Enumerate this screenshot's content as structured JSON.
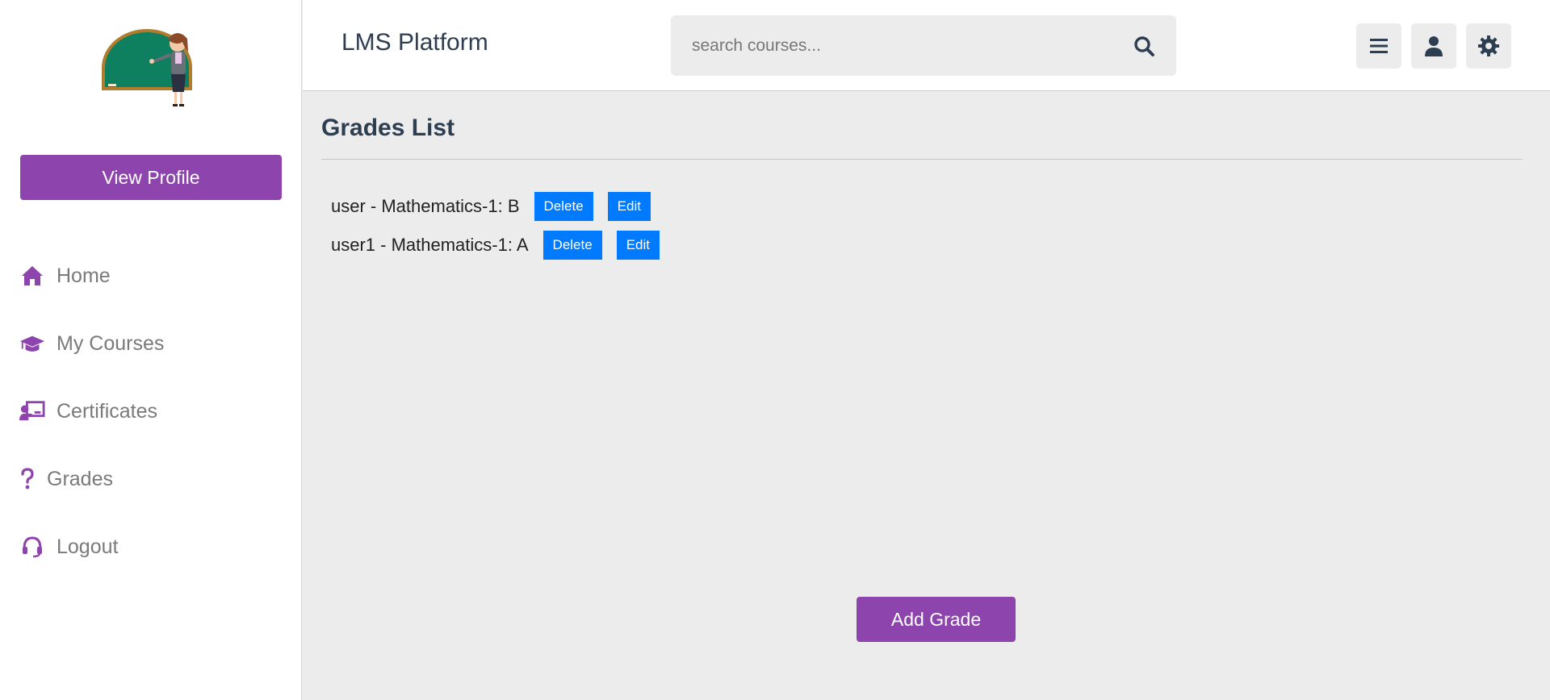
{
  "header": {
    "brand": "LMS Platform",
    "search_placeholder": "search courses...",
    "icons": [
      "search-icon",
      "menu-icon",
      "user-icon",
      "settings-icon"
    ]
  },
  "sidebar": {
    "view_profile_label": "View Profile",
    "items": [
      {
        "label": "Home",
        "icon": "home-icon"
      },
      {
        "label": "My Courses",
        "icon": "graduation-cap-icon"
      },
      {
        "label": "Certificates",
        "icon": "chalkboard-teacher-icon"
      },
      {
        "label": "Grades",
        "icon": "question-icon"
      },
      {
        "label": "Logout",
        "icon": "headset-icon"
      }
    ]
  },
  "main": {
    "title": "Grades List",
    "grades": [
      {
        "text": "user - Mathematics-1: B",
        "delete_label": "Delete",
        "edit_label": "Edit"
      },
      {
        "text": "user1 - Mathematics-1: A",
        "delete_label": "Delete",
        "edit_label": "Edit"
      }
    ],
    "add_grade_label": "Add Grade"
  },
  "colors": {
    "accent": "#8e44ad",
    "primary_button": "#007bff",
    "text_dark": "#2c3e50",
    "background": "#ececec"
  }
}
